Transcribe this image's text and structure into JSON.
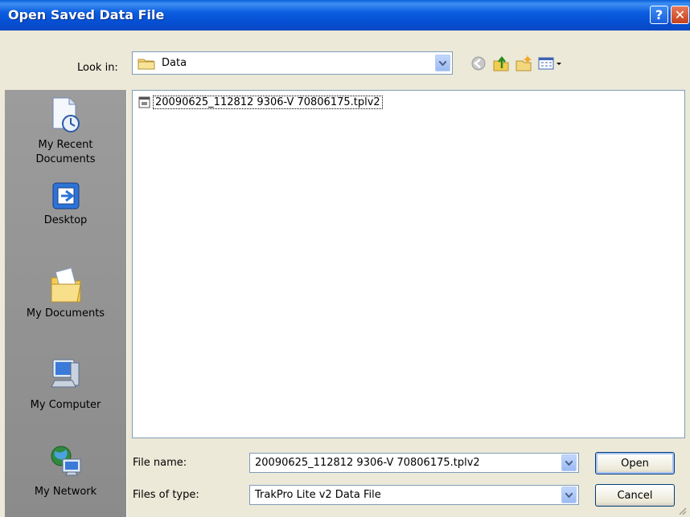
{
  "window": {
    "title": "Open Saved Data File"
  },
  "titlebar": {
    "help_label": "?",
    "close_label": "✕"
  },
  "lookin": {
    "label": "Look in:",
    "value": "Data",
    "icon": "folder-icon"
  },
  "toolbar": {
    "icons": [
      "back-icon",
      "up-folder-icon",
      "new-folder-icon",
      "views-menu-icon"
    ]
  },
  "places": [
    {
      "label": "My Recent\nDocuments",
      "icon": "recent-documents-icon"
    },
    {
      "label": "Desktop",
      "icon": "desktop-icon"
    },
    {
      "label": "My Documents",
      "icon": "my-documents-icon"
    },
    {
      "label": "My Computer",
      "icon": "my-computer-icon"
    },
    {
      "label": "My Network",
      "icon": "my-network-icon"
    }
  ],
  "files": [
    {
      "name": "20090625_112812 9306-V 70806175.tplv2",
      "icon": "data-file-icon"
    }
  ],
  "filename": {
    "label": "File name:",
    "value": "20090625_112812 9306-V 70806175.tplv2"
  },
  "filetype": {
    "label": "Files of type:",
    "value": "TrakPro Lite v2 Data File"
  },
  "buttons": {
    "open": "Open",
    "cancel": "Cancel"
  },
  "colors": {
    "titlebar": "#0a5fd8",
    "dialog_bg": "#ece9d8",
    "places_bg": "#939393",
    "border": "#7f9db9"
  }
}
